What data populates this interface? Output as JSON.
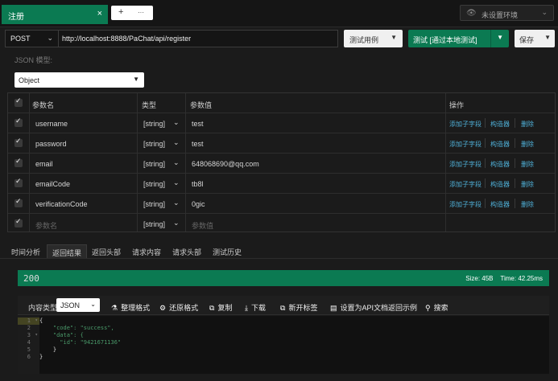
{
  "top_tabs": {
    "active_label": "注册",
    "close": "×",
    "add": "+",
    "more": "···"
  },
  "environment": {
    "label": "未设置环境"
  },
  "request": {
    "method": "POST",
    "url": "http://localhost:8888/PaChat/api/register"
  },
  "actions": {
    "test_cases": "测试用例",
    "test_button": "测试 [通过本地测试]",
    "save": "保存"
  },
  "json_model": {
    "label": "JSON 模型:",
    "value": "Object"
  },
  "params_table": {
    "headers": [
      "参数名",
      "类型",
      "参数值",
      "操作"
    ],
    "rows": [
      {
        "name": "username",
        "type": "[string]",
        "value": "test"
      },
      {
        "name": "password",
        "type": "[string]",
        "value": "test"
      },
      {
        "name": "email",
        "type": "[string]",
        "value": "648068690@qq.com"
      },
      {
        "name": "emailCode",
        "type": "[string]",
        "value": "tb8l"
      },
      {
        "name": "verificationCode",
        "type": "[string]",
        "value": "0gic"
      }
    ],
    "new_row": {
      "name_placeholder": "参数名",
      "type": "[string]",
      "value_placeholder": "参数值"
    },
    "row_actions": [
      "添加子字段",
      "构造器",
      "删除"
    ]
  },
  "result_tabs": [
    "时间分析",
    "返回结果",
    "返回头部",
    "请求内容",
    "请求头部",
    "测试历史"
  ],
  "status": {
    "code": "200",
    "size": "Size: 45B",
    "time": "Time: 42.25ms"
  },
  "response_toolbar": {
    "content_type_label": "内容类型",
    "format": "JSON",
    "buttons": [
      "整理格式",
      "还原格式",
      "复制",
      "下载",
      "新开标签",
      "设置为API文档返回示例",
      "搜索"
    ]
  },
  "response_code": {
    "line_numbers": [
      "1",
      "2",
      "3",
      "4",
      "5",
      "6"
    ],
    "lines": [
      "{",
      "    \"code\": \"success\",",
      "    \"data\": {",
      "      \"id\": \"9421671136\"",
      "    }",
      "}"
    ]
  },
  "colors": {
    "accent": "#0b7a52",
    "link": "#4fb0d8",
    "background": "#1b1b1b"
  }
}
